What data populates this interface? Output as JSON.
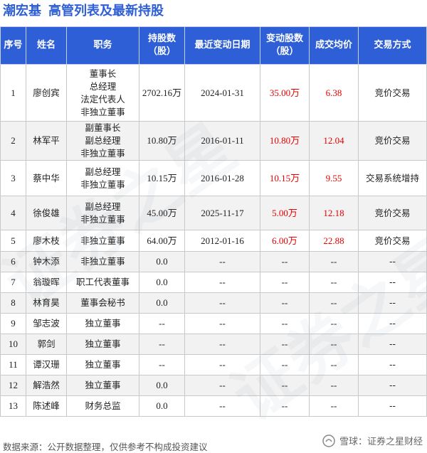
{
  "header": {
    "company": "潮宏基",
    "title": "高管列表及最新持股"
  },
  "table": {
    "columns": [
      "序号",
      "姓名",
      "职务",
      "持股数\n（股）",
      "最近变动日期",
      "变动股数\n（股）",
      "成交均价",
      "交易方式"
    ],
    "rows": [
      {
        "no": "1",
        "name": "廖创宾",
        "positions": [
          "董事长",
          "总经理",
          "法定代表人",
          "非独立董事"
        ],
        "shares": "2702.16万",
        "date": "2024-01-31",
        "change": "35.00万",
        "price": "6.38",
        "method": "竞价交易"
      },
      {
        "no": "2",
        "name": "林军平",
        "positions": [
          "副董事长",
          "副总经理",
          "非独立董事"
        ],
        "shares": "10.80万",
        "date": "2016-01-11",
        "change": "10.80万",
        "price": "12.04",
        "method": "竞价交易"
      },
      {
        "no": "3",
        "name": "蔡中华",
        "positions": [
          "副总经理",
          "非独立董事"
        ],
        "shares": "10.15万",
        "date": "2016-01-28",
        "change": "10.15万",
        "price": "9.55",
        "method": "交易系统增持"
      },
      {
        "no": "4",
        "name": "徐俊雄",
        "positions": [
          "副总经理",
          "非独立董事"
        ],
        "shares": "45.00万",
        "date": "2025-11-17",
        "change": "5.00万",
        "price": "12.18",
        "method": "竞价交易"
      },
      {
        "no": "5",
        "name": "廖木枝",
        "positions": [
          "非独立董事"
        ],
        "shares": "64.00万",
        "date": "2012-01-16",
        "change": "6.00万",
        "price": "22.88",
        "method": "竞价交易"
      },
      {
        "no": "6",
        "name": "钟木添",
        "positions": [
          "非独立董事"
        ],
        "shares": "0.0",
        "date": "--",
        "change": "--",
        "price": "--",
        "method": "--"
      },
      {
        "no": "7",
        "name": "翁璇晖",
        "positions": [
          "职工代表董事"
        ],
        "shares": "0.0",
        "date": "--",
        "change": "--",
        "price": "--",
        "method": "--"
      },
      {
        "no": "8",
        "name": "林育昊",
        "positions": [
          "董事会秘书"
        ],
        "shares": "0.0",
        "date": "--",
        "change": "--",
        "price": "--",
        "method": "--"
      },
      {
        "no": "9",
        "name": "邹志波",
        "positions": [
          "独立董事"
        ],
        "shares": "--",
        "date": "--",
        "change": "--",
        "price": "--",
        "method": "--"
      },
      {
        "no": "10",
        "name": "郭剑",
        "positions": [
          "独立董事"
        ],
        "shares": "--",
        "date": "--",
        "change": "--",
        "price": "--",
        "method": "--"
      },
      {
        "no": "11",
        "name": "谭汉珊",
        "positions": [
          "独立董事"
        ],
        "shares": "--",
        "date": "--",
        "change": "--",
        "price": "--",
        "method": "--"
      },
      {
        "no": "12",
        "name": "解浩然",
        "positions": [
          "独立董事"
        ],
        "shares": "0.0",
        "date": "--",
        "change": "--",
        "price": "--",
        "method": "--"
      },
      {
        "no": "13",
        "name": "陈述峰",
        "positions": [
          "财务总监"
        ],
        "shares": "0.0",
        "date": "--",
        "change": "--",
        "price": "--",
        "method": "--"
      }
    ]
  },
  "footer": {
    "source": "数据来源：公开数据整理，仅供参考不构成投资建议",
    "brand": "雪球：证券之星财经"
  },
  "watermark": "证券之星",
  "colors": {
    "header_bg": "#2f5fd6",
    "title": "#2f5fd6",
    "change_red": "#e60000"
  },
  "icons": {
    "brand": "snowball-logo-icon"
  }
}
